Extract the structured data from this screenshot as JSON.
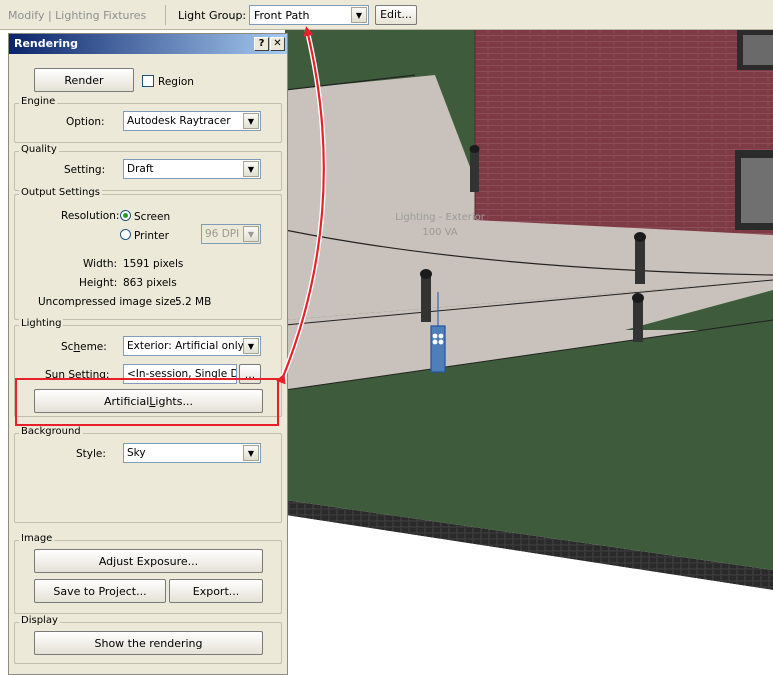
{
  "topbar": {
    "context": "Modify | Lighting Fixtures",
    "light_group_label": "Light Group:",
    "light_group_value": "Front Path",
    "edit_button": "Edit..."
  },
  "dialog": {
    "title": "Rendering",
    "help_button": "?",
    "close_button": "✕",
    "render_button": "Render",
    "region_label": "Region",
    "engine": {
      "group": "Engine",
      "option_label": "Option:",
      "option_value": "Autodesk Raytracer"
    },
    "quality": {
      "group": "Quality",
      "setting_label": "Setting:",
      "setting_value": "Draft"
    },
    "output": {
      "group": "Output Settings",
      "resolution_label": "Resolution:",
      "screen_label": "Screen",
      "printer_label": "Printer",
      "dpi_value": "96 DPI",
      "width_label": "Width:",
      "width_value": "1591 pixels",
      "height_label": "Height:",
      "height_value": "863 pixels",
      "size_label": "Uncompressed image size:",
      "size_value": "5.2 MB",
      "resolution_selected": "Screen"
    },
    "lighting": {
      "group": "Lighting",
      "scheme_prefix": "Sc",
      "scheme_underlined": "h",
      "scheme_suffix": "eme:",
      "scheme_value": "Exterior: Artificial only",
      "sun_prefix": "S",
      "sun_underlined": "u",
      "sun_suffix": "n Setting:",
      "sun_value": "<In-session, Single Da",
      "sun_browse": "...",
      "artificial_prefix": "Artificial ",
      "artificial_underlined": "L",
      "artificial_suffix": "ights..."
    },
    "background": {
      "group": "Background",
      "style_label": "Style:",
      "style_value": "Sky"
    },
    "image": {
      "group": "Image",
      "adjust_exposure": "Adjust Exposure...",
      "save_to_project": "Save to Project...",
      "export": "Export..."
    },
    "display": {
      "group": "Display",
      "show_rendering": "Show the rendering"
    }
  },
  "viewport": {
    "tag_line1": "Lighting - Exterior",
    "tag_line2": "100 VA"
  },
  "colors": {
    "highlight": "#e8202a",
    "grass": "#3e5c3c",
    "path": "#c9c1bb",
    "brick": "#7e3b45"
  }
}
